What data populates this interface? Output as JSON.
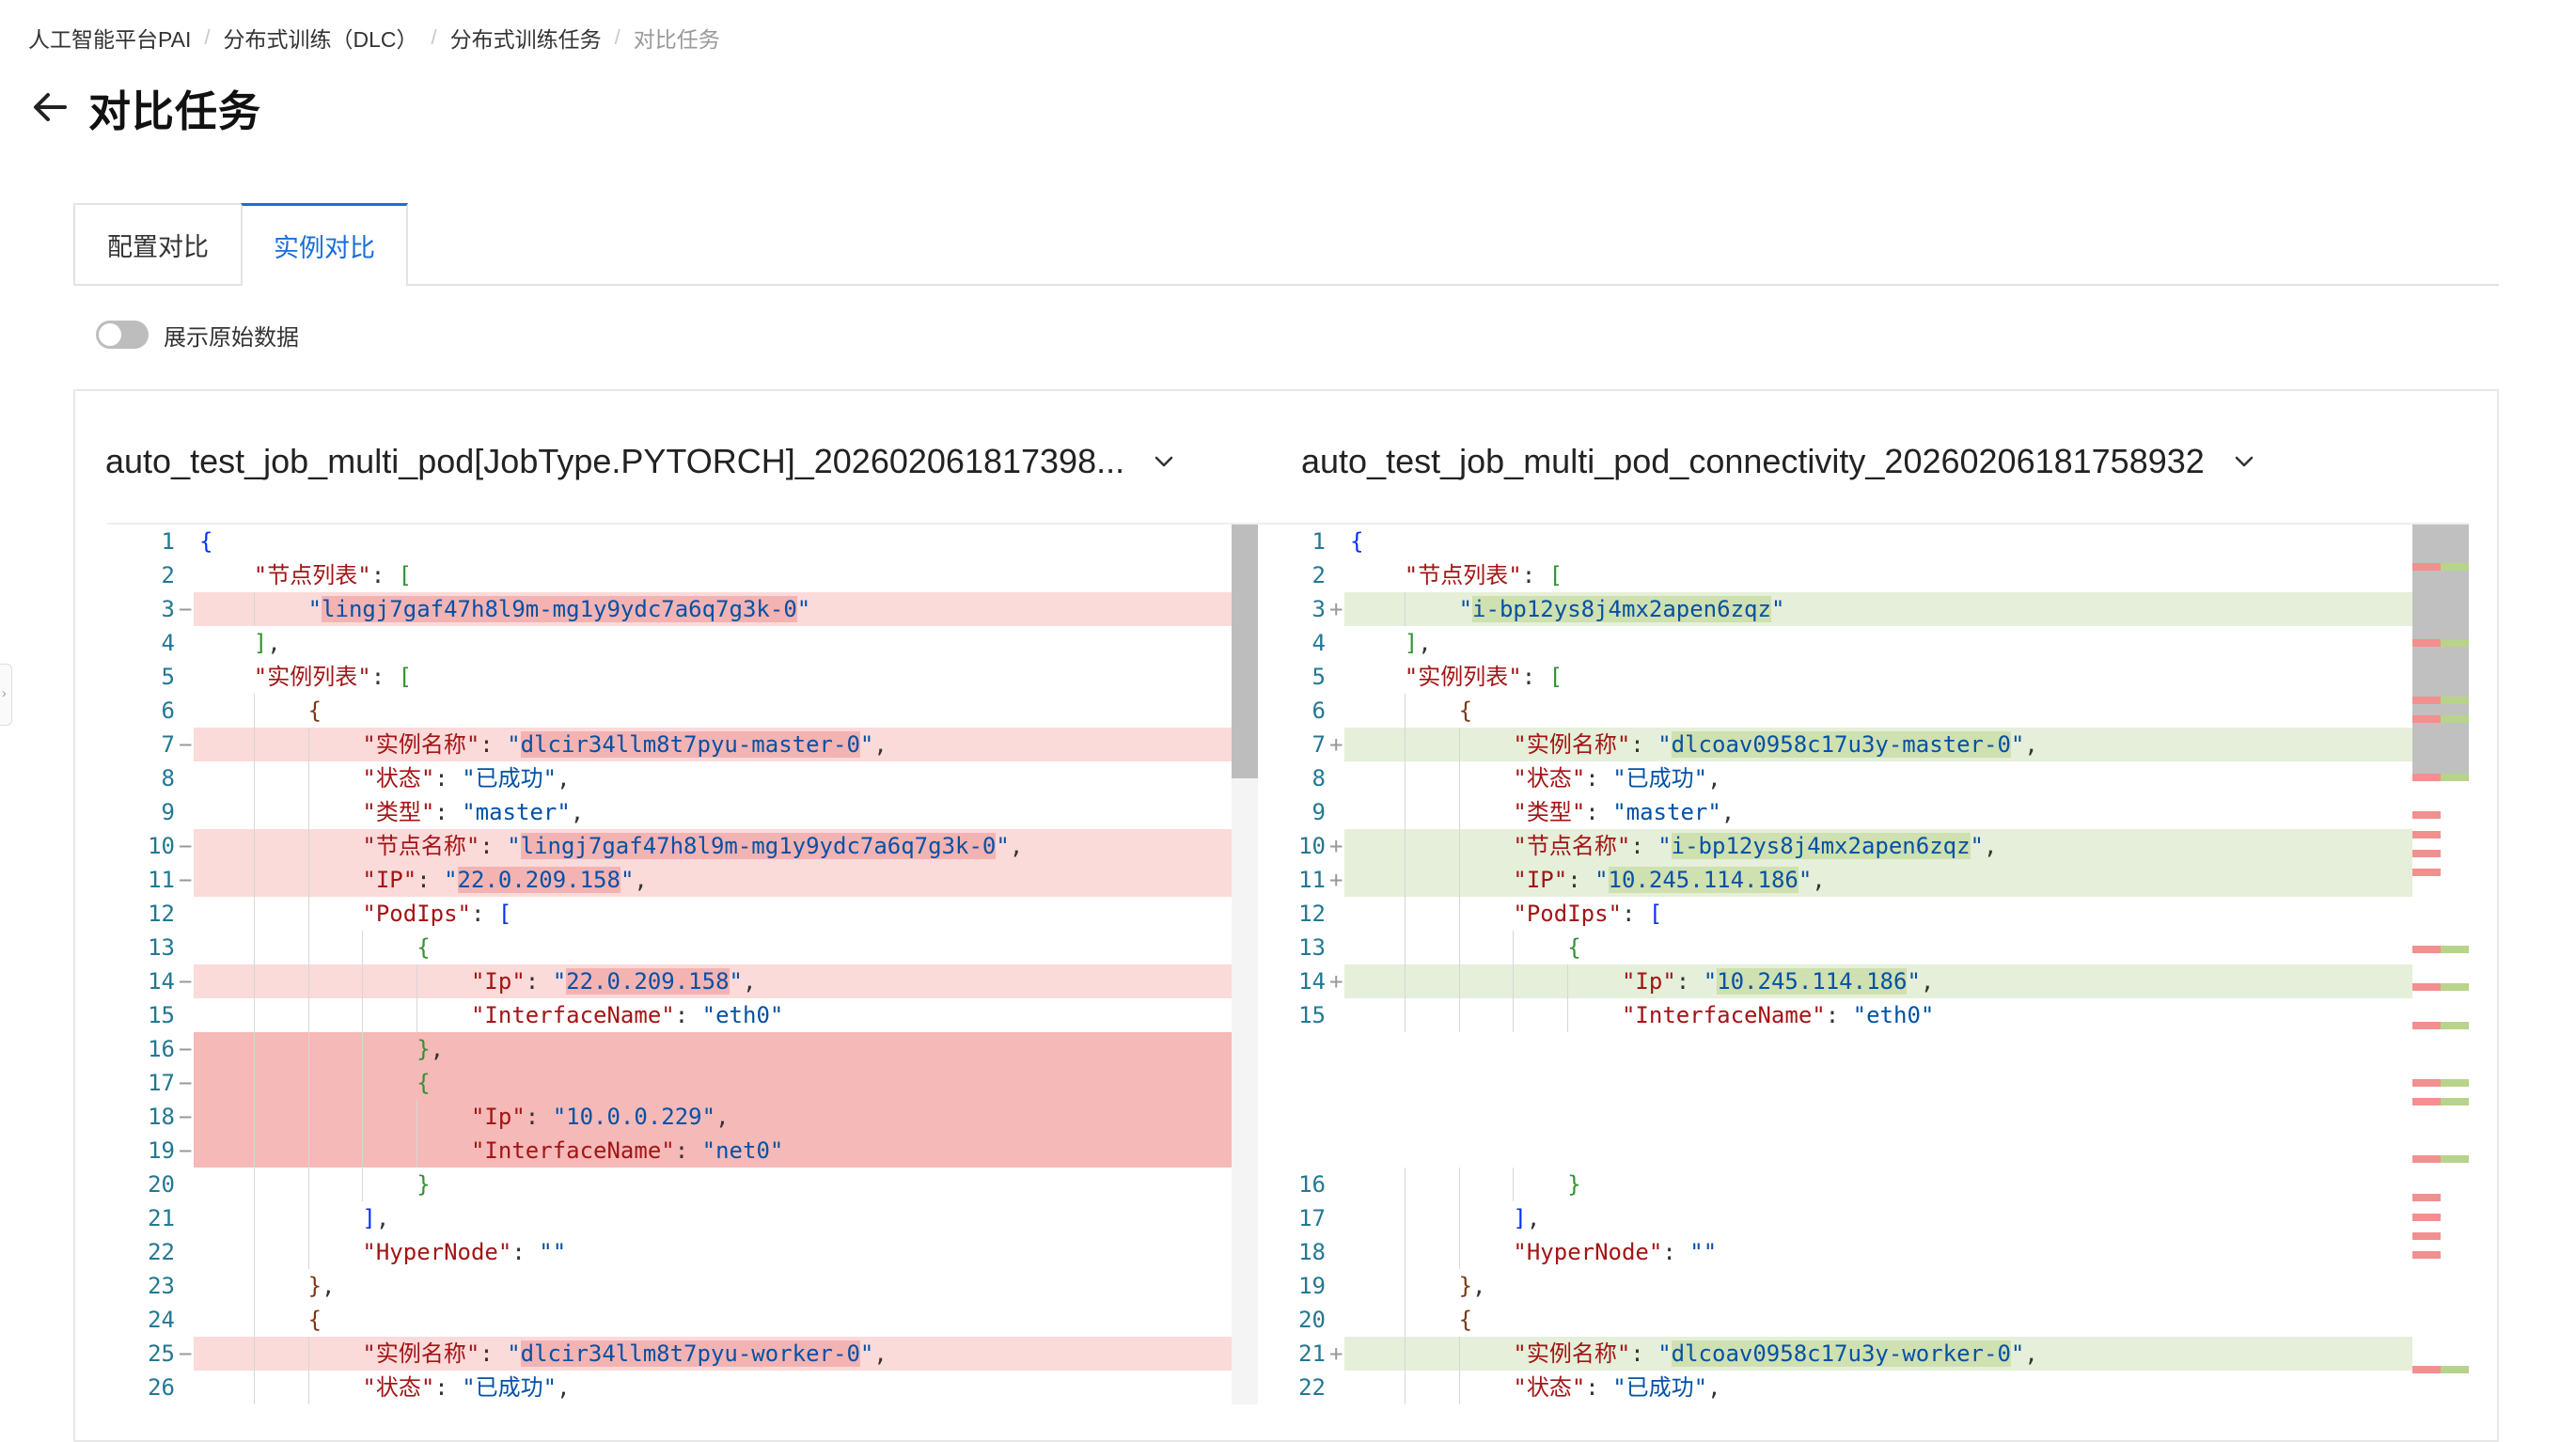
{
  "breadcrumb": [
    "人工智能平台PAI",
    "分布式训练（DLC）",
    "分布式训练任务",
    "对比任务"
  ],
  "page_title": "对比任务",
  "tabs": [
    "配置对比",
    "实例对比"
  ],
  "active_tab": "实例对比",
  "toggle": {
    "label": "展示原始数据",
    "on": false
  },
  "left_file": "auto_test_job_multi_pod[JobType.PYTORCH]_202602061817398...",
  "right_file": "auto_test_job_multi_pod_connectivity_20260206181758932",
  "colors": {
    "accent": "#1b6ed6",
    "deleted_line": "#fbdada",
    "deleted_block": "#f5b9b8",
    "inserted_line": "#e5efd9"
  },
  "icons": {
    "back": "arrow-left-icon",
    "dropdown": "chevron-down-icon"
  },
  "left_lines": [
    {
      "n": "1",
      "m": "",
      "t": "{",
      "st": ""
    },
    {
      "n": "2",
      "m": "",
      "t": "    \"节点列表\": [",
      "st": ""
    },
    {
      "n": "3",
      "m": "−",
      "t": "        \"lingj7gaf47h8l9m-mg1y9ydc7a6q7g3k-0\"",
      "st": "del"
    },
    {
      "n": "4",
      "m": "",
      "t": "    ],",
      "st": ""
    },
    {
      "n": "5",
      "m": "",
      "t": "    \"实例列表\": [",
      "st": ""
    },
    {
      "n": "6",
      "m": "",
      "t": "        {",
      "st": ""
    },
    {
      "n": "7",
      "m": "−",
      "t": "            \"实例名称\": \"dlcir34llm8t7pyu-master-0\",",
      "st": "del"
    },
    {
      "n": "8",
      "m": "",
      "t": "            \"状态\": \"已成功\",",
      "st": ""
    },
    {
      "n": "9",
      "m": "",
      "t": "            \"类型\": \"master\",",
      "st": ""
    },
    {
      "n": "10",
      "m": "−",
      "t": "            \"节点名称\": \"lingj7gaf47h8l9m-mg1y9ydc7a6q7g3k-0\",",
      "st": "del"
    },
    {
      "n": "11",
      "m": "−",
      "t": "            \"IP\": \"22.0.209.158\",",
      "st": "del"
    },
    {
      "n": "12",
      "m": "",
      "t": "            \"PodIps\": [",
      "st": ""
    },
    {
      "n": "13",
      "m": "",
      "t": "                {",
      "st": ""
    },
    {
      "n": "14",
      "m": "−",
      "t": "                    \"Ip\": \"22.0.209.158\",",
      "st": "del"
    },
    {
      "n": "15",
      "m": "",
      "t": "                    \"InterfaceName\": \"eth0\"",
      "st": ""
    },
    {
      "n": "16",
      "m": "−",
      "t": "                },",
      "st": "delfull"
    },
    {
      "n": "17",
      "m": "−",
      "t": "                {",
      "st": "delfull"
    },
    {
      "n": "18",
      "m": "−",
      "t": "                    \"Ip\": \"10.0.0.229\",",
      "st": "delfull"
    },
    {
      "n": "19",
      "m": "−",
      "t": "                    \"InterfaceName\": \"net0\"",
      "st": "delfull"
    },
    {
      "n": "20",
      "m": "",
      "t": "                }",
      "st": ""
    },
    {
      "n": "21",
      "m": "",
      "t": "            ],",
      "st": ""
    },
    {
      "n": "22",
      "m": "",
      "t": "            \"HyperNode\": \"\"",
      "st": ""
    },
    {
      "n": "23",
      "m": "",
      "t": "        },",
      "st": ""
    },
    {
      "n": "24",
      "m": "",
      "t": "        {",
      "st": ""
    },
    {
      "n": "25",
      "m": "−",
      "t": "            \"实例名称\": \"dlcir34llm8t7pyu-worker-0\",",
      "st": "del"
    },
    {
      "n": "26",
      "m": "",
      "t": "            \"状态\": \"已成功\",",
      "st": ""
    }
  ],
  "right_lines": [
    {
      "n": "1",
      "m": "",
      "t": "{",
      "st": ""
    },
    {
      "n": "2",
      "m": "",
      "t": "    \"节点列表\": [",
      "st": ""
    },
    {
      "n": "3",
      "m": "+",
      "t": "        \"i-bp12ys8j4mx2apen6zqz\"",
      "st": "ins"
    },
    {
      "n": "4",
      "m": "",
      "t": "    ],",
      "st": ""
    },
    {
      "n": "5",
      "m": "",
      "t": "    \"实例列表\": [",
      "st": ""
    },
    {
      "n": "6",
      "m": "",
      "t": "        {",
      "st": ""
    },
    {
      "n": "7",
      "m": "+",
      "t": "            \"实例名称\": \"dlcoav0958c17u3y-master-0\",",
      "st": "ins"
    },
    {
      "n": "8",
      "m": "",
      "t": "            \"状态\": \"已成功\",",
      "st": ""
    },
    {
      "n": "9",
      "m": "",
      "t": "            \"类型\": \"master\",",
      "st": ""
    },
    {
      "n": "10",
      "m": "+",
      "t": "            \"节点名称\": \"i-bp12ys8j4mx2apen6zqz\",",
      "st": "ins"
    },
    {
      "n": "11",
      "m": "+",
      "t": "            \"IP\": \"10.245.114.186\",",
      "st": "ins"
    },
    {
      "n": "12",
      "m": "",
      "t": "            \"PodIps\": [",
      "st": ""
    },
    {
      "n": "13",
      "m": "",
      "t": "                {",
      "st": ""
    },
    {
      "n": "14",
      "m": "+",
      "t": "                    \"Ip\": \"10.245.114.186\",",
      "st": "ins"
    },
    {
      "n": "15",
      "m": "",
      "t": "                    \"InterfaceName\": \"eth0\"",
      "st": ""
    },
    {
      "n": "",
      "m": "",
      "t": "",
      "st": "filler"
    },
    {
      "n": "",
      "m": "",
      "t": "",
      "st": "filler"
    },
    {
      "n": "",
      "m": "",
      "t": "",
      "st": "filler"
    },
    {
      "n": "",
      "m": "",
      "t": "",
      "st": "filler"
    },
    {
      "n": "16",
      "m": "",
      "t": "                }",
      "st": ""
    },
    {
      "n": "17",
      "m": "",
      "t": "            ],",
      "st": ""
    },
    {
      "n": "18",
      "m": "",
      "t": "            \"HyperNode\": \"\"",
      "st": ""
    },
    {
      "n": "19",
      "m": "",
      "t": "        },",
      "st": ""
    },
    {
      "n": "20",
      "m": "",
      "t": "        {",
      "st": ""
    },
    {
      "n": "21",
      "m": "+",
      "t": "            \"实例名称\": \"dlcoav0958c17u3y-worker-0\",",
      "st": "ins"
    },
    {
      "n": "22",
      "m": "",
      "t": "            \"状态\": \"已成功\",",
      "st": ""
    }
  ]
}
